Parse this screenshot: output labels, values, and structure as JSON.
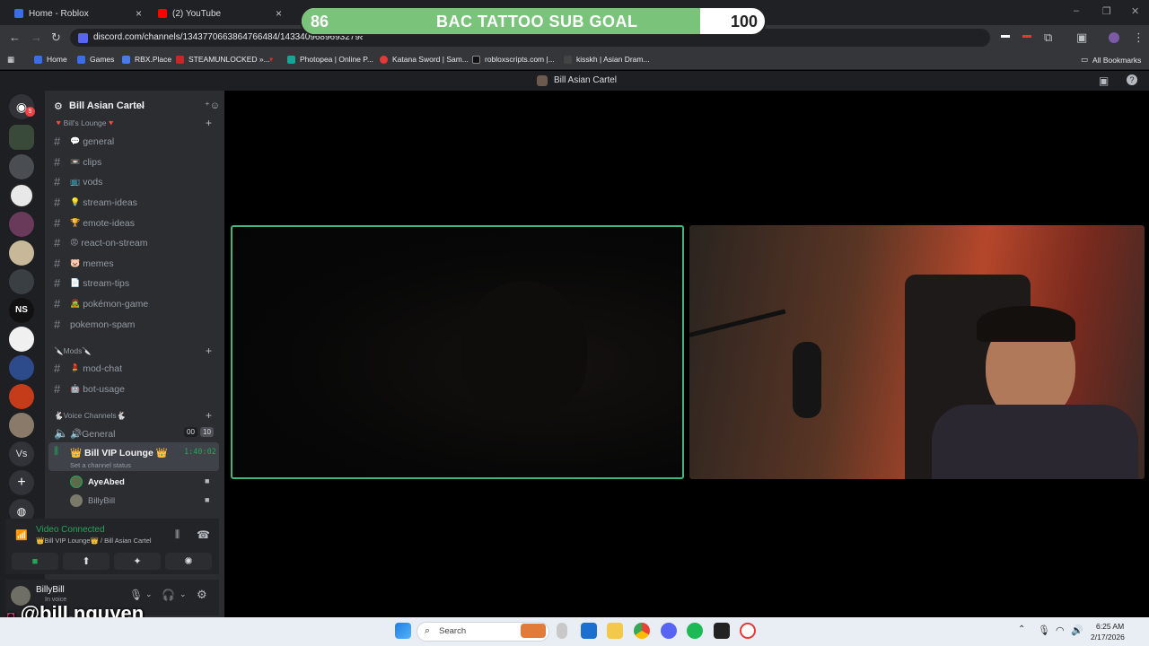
{
  "browser": {
    "tabs": [
      {
        "label": "Home - Roblox"
      },
      {
        "label": "(2) YouTube"
      }
    ],
    "url": "discord.com/channels/1343770663864766484/1433409689693279877",
    "bookmarks": [
      "Home",
      "Games",
      "RBX.Place",
      "STEAMUNLOCKED »...",
      "Photopea | Online P...",
      "Katana Sword | Sam...",
      "robloxscripts.com |...",
      "kisskh | Asian Dram..."
    ],
    "all_bookmarks": "All Bookmarks"
  },
  "overlay": {
    "current": "86",
    "title": "BAC TATTOO SUB GOAL",
    "goal": "100",
    "progress_fraction": 0.86,
    "watermark": "@bill.nguyen"
  },
  "discord": {
    "window_title": "Bill Asian Cartel",
    "server_name": "Bill Asian Cartel",
    "mention_badge": "5",
    "categories": {
      "lounge": "🔻Bill's Lounge🔻",
      "mods": "🔪Mods🔪",
      "voice": "🐇Voice Channels🐇"
    },
    "text_channels": [
      {
        "emoji": "💬",
        "name": "general"
      },
      {
        "emoji": "📼",
        "name": "clips"
      },
      {
        "emoji": "📺",
        "name": "vods"
      },
      {
        "emoji": "💡",
        "name": "stream-ideas"
      },
      {
        "emoji": "🏆",
        "name": "emote-ideas"
      },
      {
        "emoji": "😡",
        "name": "react-on-stream"
      },
      {
        "emoji": "🐷",
        "name": "memes"
      },
      {
        "emoji": "📄",
        "name": "stream-tips"
      },
      {
        "emoji": "🧟",
        "name": "pokémon-game"
      },
      {
        "emoji": "",
        "name": "pokemon-spam"
      }
    ],
    "mod_channels": [
      {
        "emoji": "💄",
        "name": "mod-chat"
      },
      {
        "emoji": "🤖",
        "name": "bot-usage"
      }
    ],
    "voice_channels": {
      "general": {
        "label": "🔊General",
        "count_a": "00",
        "count_b": "10"
      },
      "vip": {
        "label": "👑 Bill VIP Lounge 👑",
        "timer": "1:40:02",
        "status": "Set a channel status"
      }
    },
    "voice_members": [
      "AyeAbed",
      "BillyBill"
    ],
    "connection": {
      "status": "Video Connected",
      "location": "👑Bill VIP Lounge👑 / Bill Asian Cartel"
    },
    "user": {
      "name": "BillyBill",
      "status": "In voice"
    }
  },
  "taskbar": {
    "search_placeholder": "Search",
    "time": "6:25 AM",
    "date": "2/17/2026"
  },
  "colors": {
    "goal_fill": "#79c37b",
    "speaking_border": "#43b581",
    "discord_sidebar": "#2b2d31",
    "connected_green": "#23a55a"
  }
}
